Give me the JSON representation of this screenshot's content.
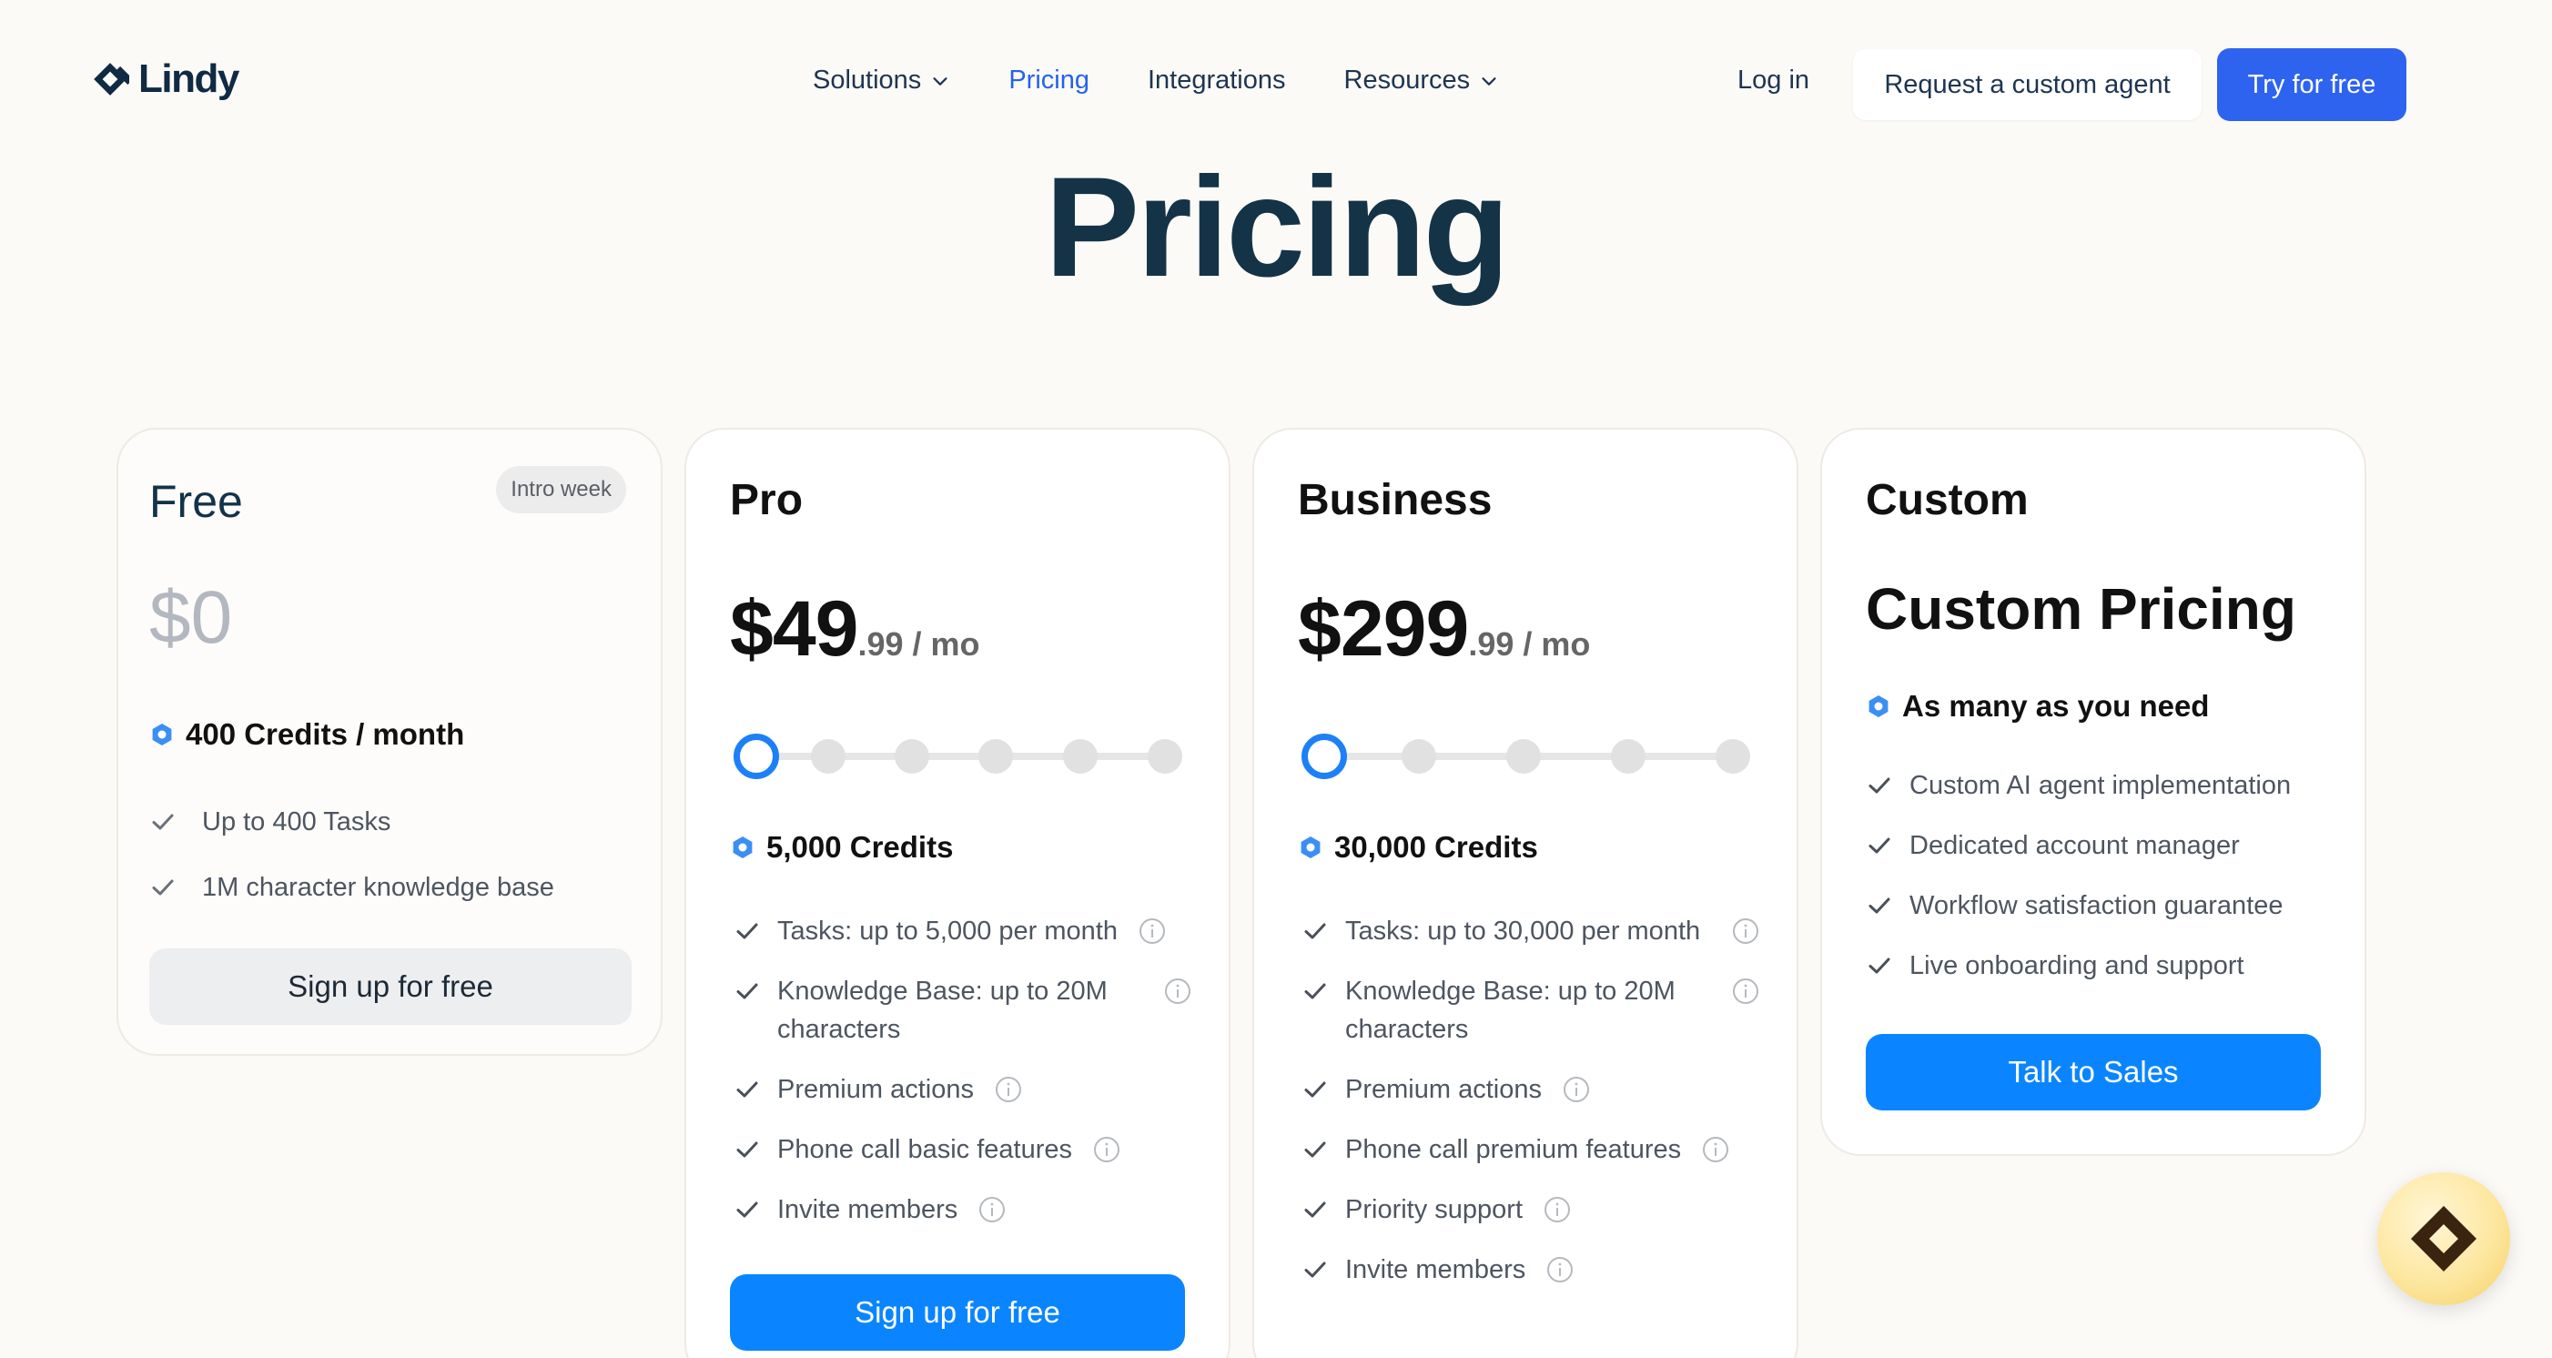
{
  "nav": {
    "brand": "Lindy",
    "items": [
      {
        "label": "Solutions",
        "dropdown": true
      },
      {
        "label": "Pricing",
        "active": true
      },
      {
        "label": "Integrations"
      },
      {
        "label": "Resources",
        "dropdown": true
      }
    ],
    "login": "Log in",
    "custom_agent": "Request a custom agent",
    "try_free": "Try for free"
  },
  "title": "Pricing",
  "plans": {
    "free": {
      "name": "Free",
      "badge": "Intro week",
      "price": "$0",
      "credits": "400 Credits / month",
      "features": [
        "Up to 400 Tasks",
        "1M character knowledge base"
      ],
      "cta": "Sign up for free"
    },
    "pro": {
      "name": "Pro",
      "price_main": "$49",
      "price_suffix": ".99 / mo",
      "credits": "5,000 Credits",
      "slider_steps": 6,
      "slider_selected": 0,
      "features": [
        "Tasks: up to 5,000 per month",
        "Knowledge Base: up to 20M characters",
        "Premium actions",
        "Phone call basic features",
        "Invite members"
      ],
      "cta": "Sign up for free"
    },
    "business": {
      "name": "Business",
      "price_main": "$299",
      "price_suffix": ".99 / mo",
      "credits": "30,000 Credits",
      "slider_steps": 5,
      "slider_selected": 0,
      "features": [
        "Tasks: up to 30,000 per month",
        "Knowledge Base: up to 20M characters",
        "Premium actions",
        "Phone call premium features",
        "Priority support",
        "Invite members"
      ]
    },
    "custom": {
      "name": "Custom",
      "price": "Custom Pricing",
      "credits": "As many as you need",
      "features": [
        "Custom AI agent implementation",
        "Dedicated account manager",
        "Workflow satisfaction guarantee",
        "Live onboarding and support"
      ],
      "cta": "Talk to Sales"
    }
  },
  "colors": {
    "accent": "#2e63f0",
    "button_primary": "#0a85ff",
    "credit_icon": "#3b8ef5",
    "title": "#143347"
  },
  "icons": {
    "logo": "lindy-diamond-icon",
    "dropdown": "chevron-down-icon",
    "credit": "hexagon-credit-icon",
    "check": "check-icon",
    "info": "info-icon",
    "chat": "chat-launcher-icon"
  }
}
